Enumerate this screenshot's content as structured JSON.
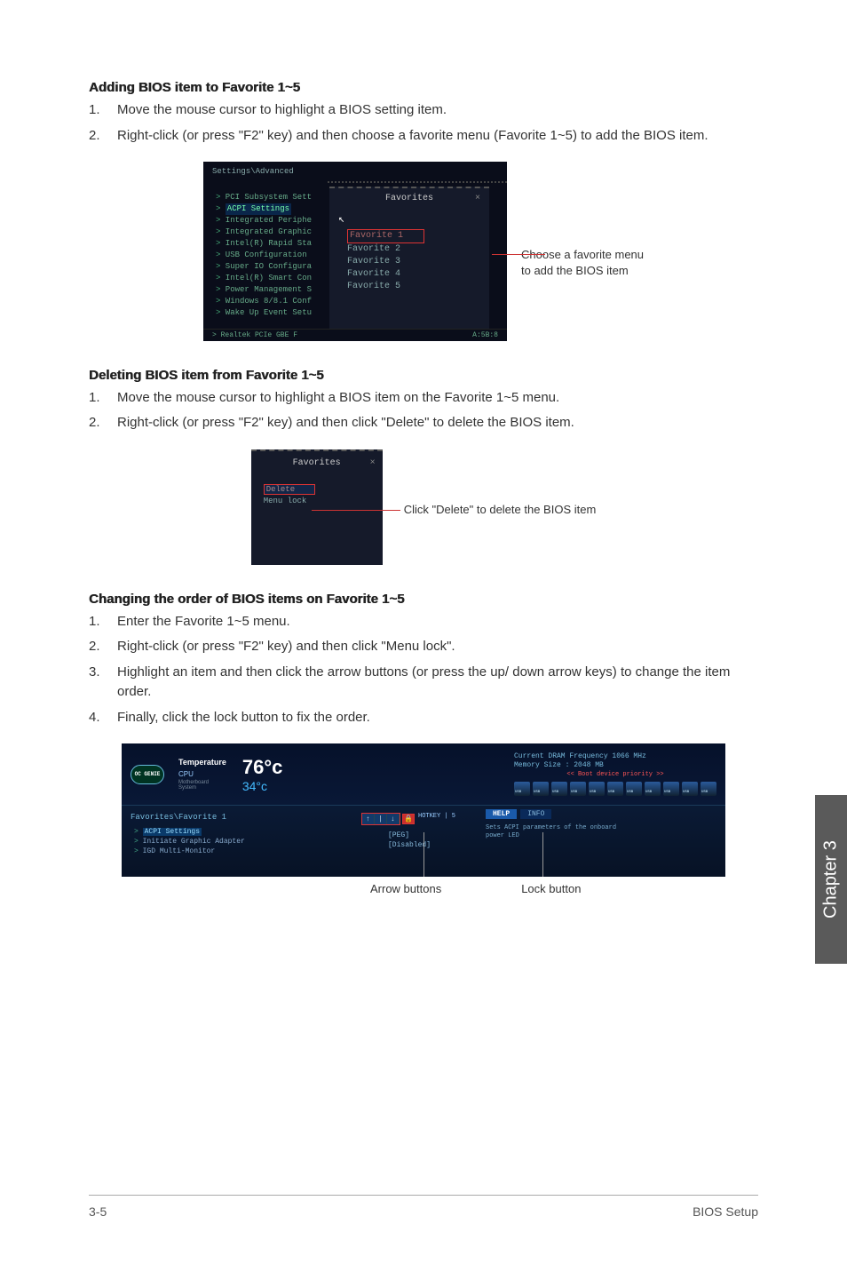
{
  "section1": {
    "title": "Adding BIOS item to Favorite 1~5",
    "steps": [
      "Move the mouse cursor to highlight a BIOS setting item.",
      "Right-click (or press \"F2\" key) and then choose a favorite menu (Favorite 1~5) to add the BIOS item."
    ]
  },
  "fig1": {
    "breadcrumb": "Settings\\Advanced",
    "items": [
      "PCI Subsystem Sett",
      "ACPI Settings",
      "Integrated Periphe",
      "Integrated Graphic",
      "Intel(R) Rapid Sta",
      "USB Configuration",
      "Super IO Configura",
      "Intel(R) Smart Con",
      "Power Management S",
      "Windows 8/8.1 Conf",
      "Wake Up Event Setu"
    ],
    "footer_left": "Realtek PCIe GBE F",
    "footer_right": "A:5B:8",
    "popup_title": "Favorites",
    "popup_close": "×",
    "fav_options": [
      "Favorite 1",
      "Favorite 2",
      "Favorite 3",
      "Favorite 4",
      "Favorite 5"
    ],
    "callout_l1": "Choose a favorite menu",
    "callout_l2": "to add the BIOS item"
  },
  "section2": {
    "title": "Deleting BIOS item from Favorite 1~5",
    "steps": [
      "Move the mouse cursor to highlight a BIOS item on the Favorite 1~5 menu.",
      "Right-click (or press \"F2\" key) and then click \"Delete\" to delete the BIOS item."
    ]
  },
  "fig2": {
    "popup_title": "Favorites",
    "popup_close": "×",
    "delete_label": "Delete",
    "menulock_label": "Menu lock",
    "callout": "Click \"Delete\" to delete the BIOS item"
  },
  "section3": {
    "title": "Changing the order of BIOS items on Favorite 1~5",
    "steps": [
      "Enter the Favorite 1~5 menu.",
      "Right-click (or press \"F2\" key) and then click \"Menu lock\".",
      "Highlight an item and then click the arrow buttons (or press the up/ down arrow keys) to change the item order.",
      "Finally, click the lock button to fix the order."
    ]
  },
  "fig3": {
    "oc_label": "OC GENIE",
    "temperature_label": "Temperature",
    "cpu_label": "CPU",
    "mb_label_l1": "Motherboard",
    "mb_label_l2": "System",
    "cpu_temp": "76°c",
    "mb_temp": "34°c",
    "dram_line": "Current DRAM Frequency 1066 MHz",
    "mem_line": "Memory Size : 2048 MB",
    "boot_label": "Boot device priority",
    "fav_path": "Favorites\\Favorite 1",
    "rows": [
      "ACPI Settings",
      "Initiate Graphic Adapter",
      "IGD Multi-Monitor"
    ],
    "vals": [
      "[PEG]",
      "[Disabled]"
    ],
    "hotkey": "HOTKEY | 5",
    "help_tab": "HELP",
    "info_tab": "INFO",
    "help_text": "Sets ACPI parameters of the onboard power LED",
    "arrow_label": "Arrow buttons",
    "lock_label": "Lock button"
  },
  "chapter_tab": "Chapter 3",
  "footer": {
    "page": "3-5",
    "title": "BIOS Setup"
  }
}
